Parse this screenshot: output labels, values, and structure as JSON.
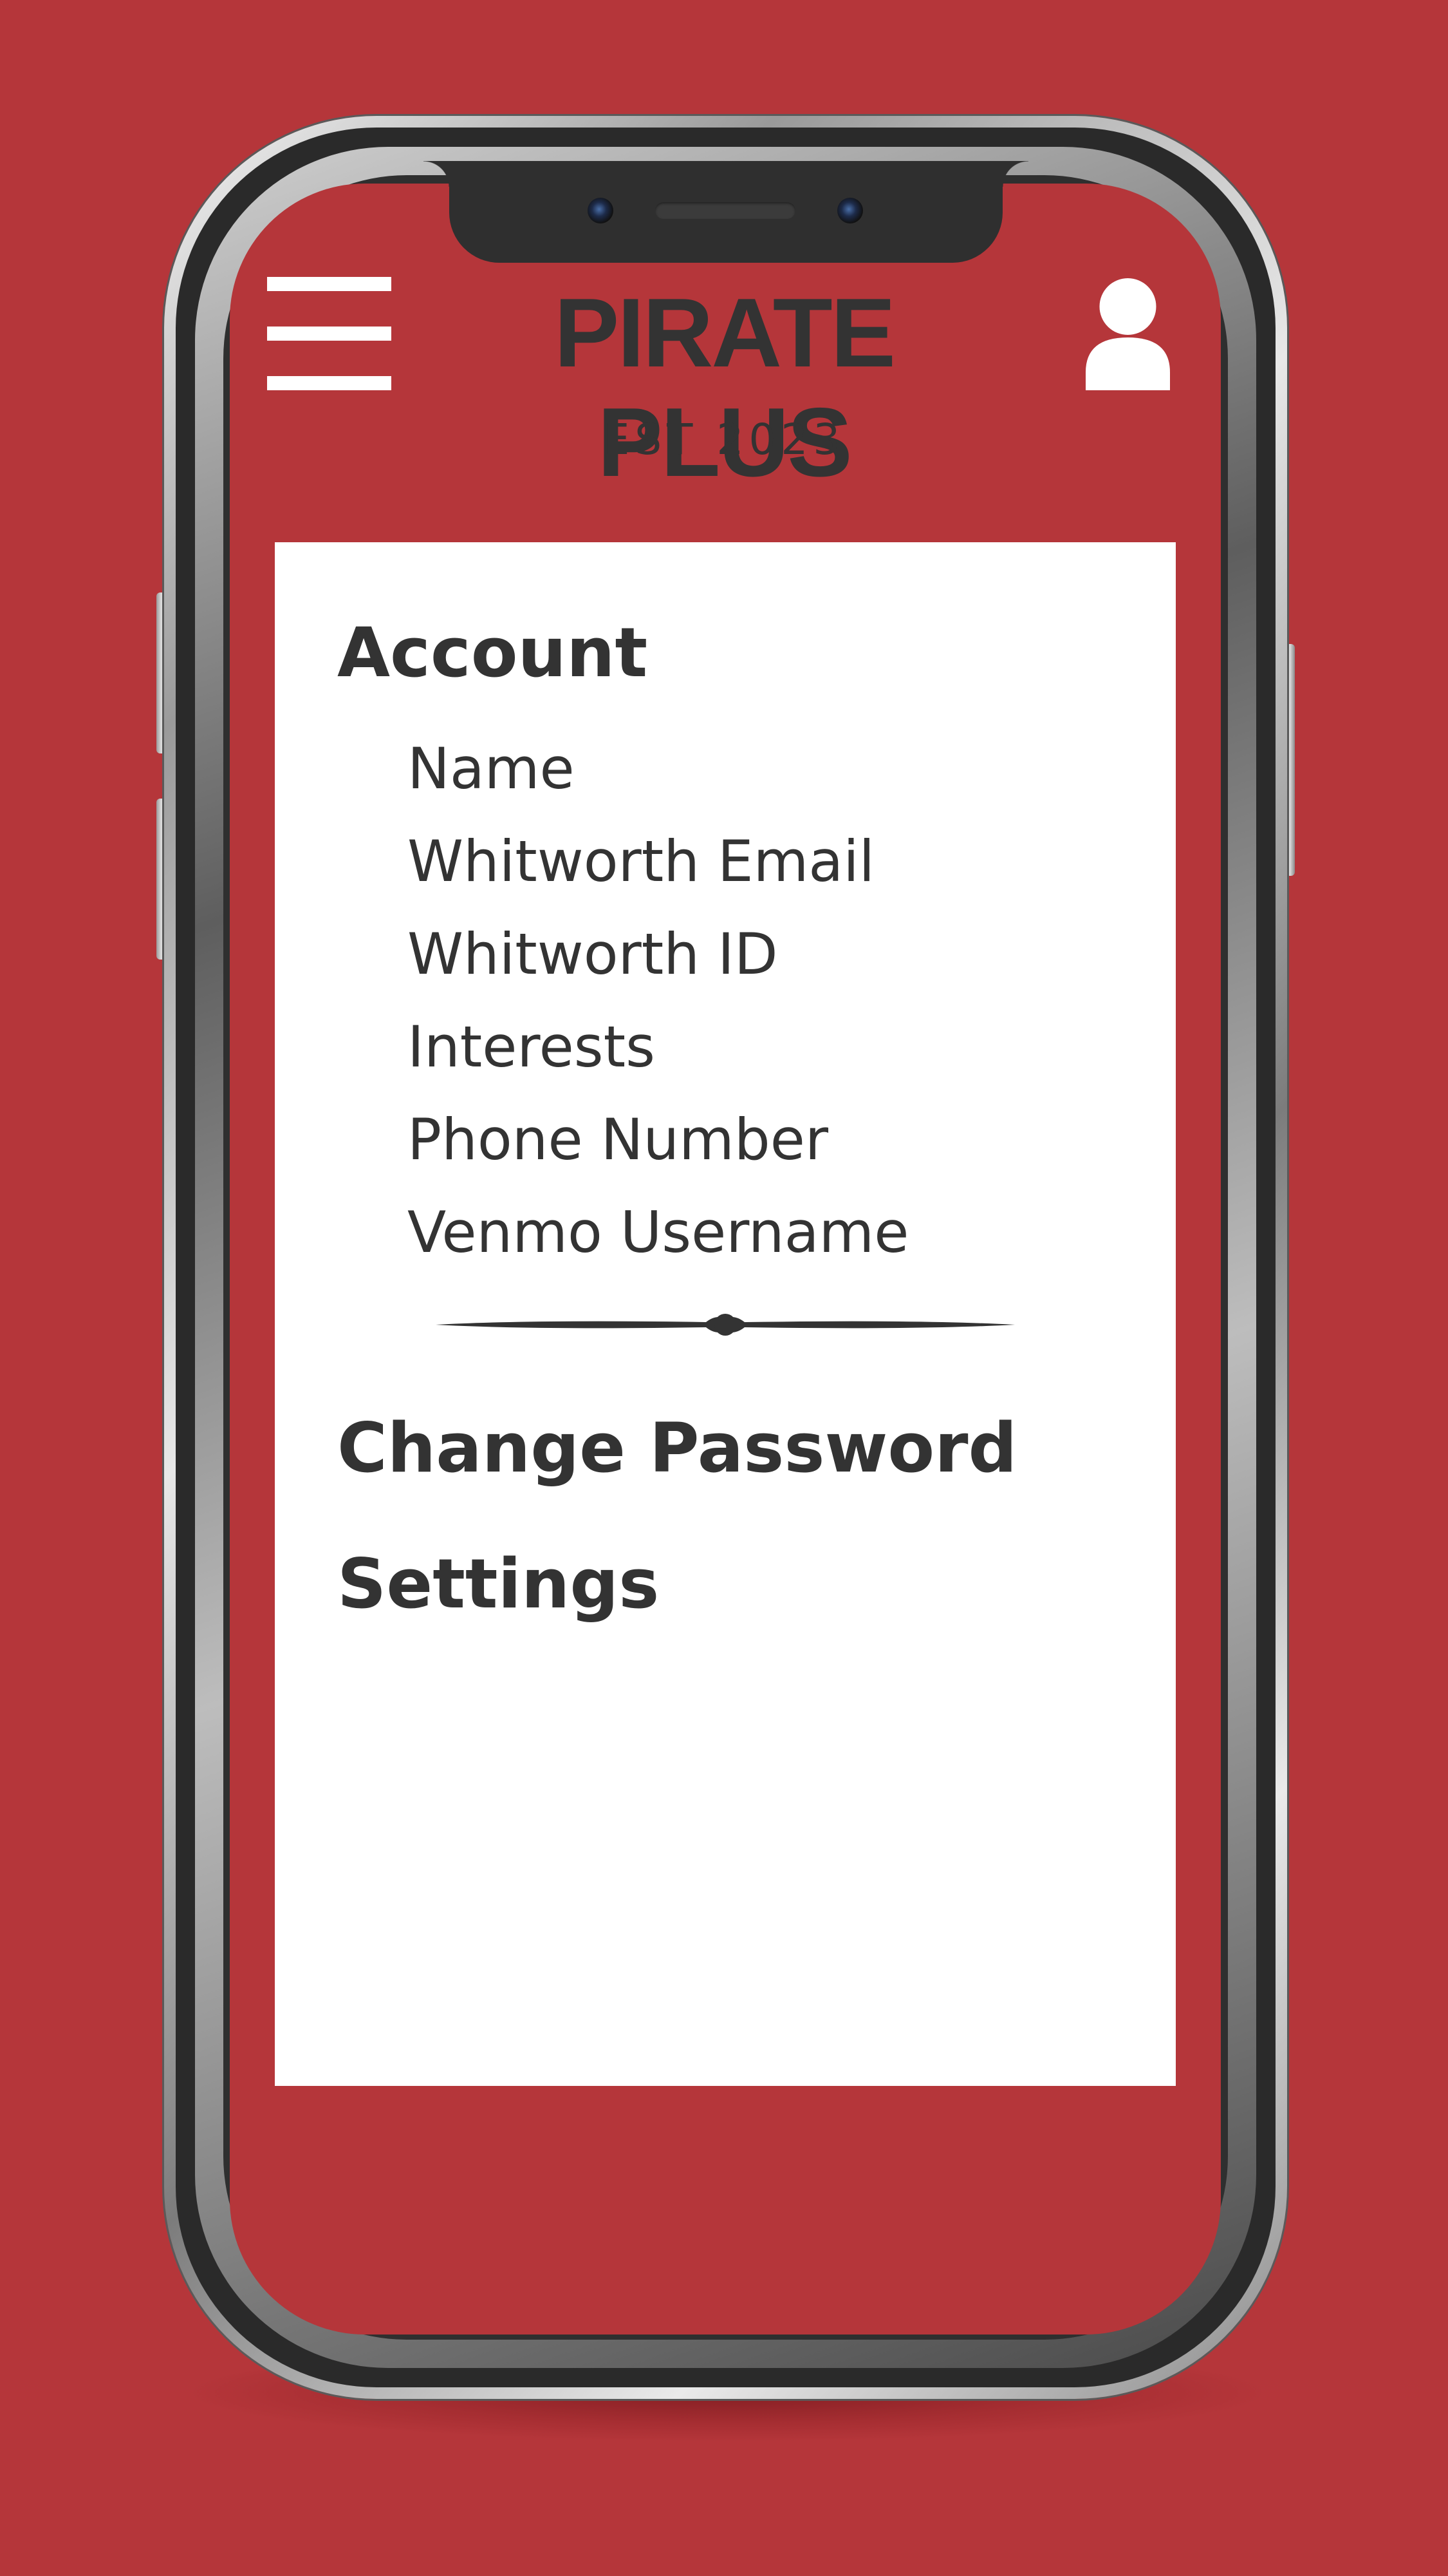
{
  "header": {
    "title": "PIRATE PLUS",
    "subtitle": "EST 2023"
  },
  "icons": {
    "menu": "hamburger-menu-icon",
    "profile": "user-profile-icon",
    "divider": "ornamental-divider"
  },
  "account": {
    "heading": "Account",
    "items": [
      "Name",
      "Whitworth Email",
      "Whitworth ID",
      "Interests",
      "Phone Number",
      "Venmo Username"
    ]
  },
  "change_password": {
    "label": "Change Password"
  },
  "settings": {
    "label": "Settings"
  },
  "colors": {
    "background": "#b5363a",
    "panel": "#ffffff",
    "text": "#333333",
    "icon": "#ffffff"
  }
}
